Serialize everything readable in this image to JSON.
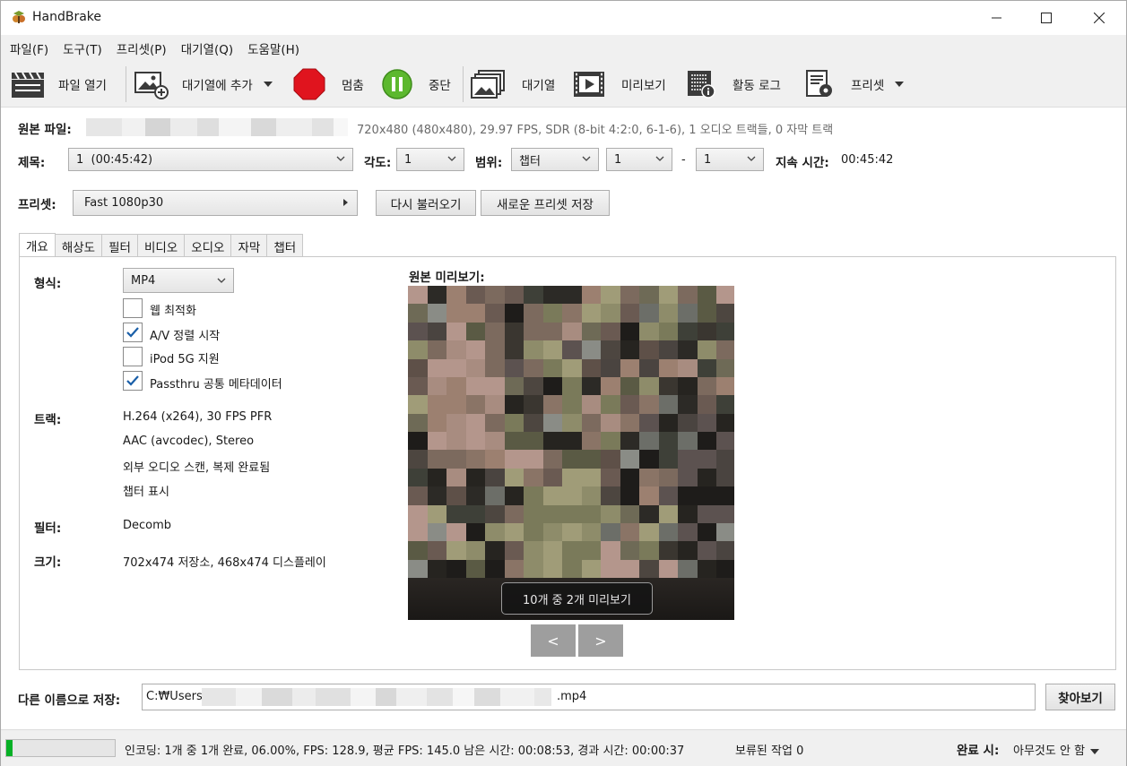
{
  "window": {
    "title": "HandBrake"
  },
  "menu": [
    "파일(F)",
    "도구(T)",
    "프리셋(P)",
    "대기열(Q)",
    "도움말(H)"
  ],
  "toolbar": {
    "open_source": "파일 열기",
    "add_to_queue": "대기열에 추가",
    "stop": "멈춤",
    "pause": "중단",
    "queue": "대기열",
    "preview": "미리보기",
    "activity_log": "활동 로그",
    "presets": "프리셋"
  },
  "source": {
    "label": "원본 파일:",
    "info": "720x480 (480x480), 29.97 FPS, SDR (8-bit 4:2:0, 6-1-6), 1 오디오 트랙들, 0 자막 트랙"
  },
  "title_row": {
    "title_label": "제목:",
    "title_value": "1  (00:45:42)",
    "angle_label": "각도:",
    "angle_value": "1",
    "range_label": "범위:",
    "range_type": "챕터",
    "range_start": "1",
    "range_sep": "-",
    "range_end": "1",
    "duration_label": "지속 시간:",
    "duration_value": "00:45:42"
  },
  "preset_row": {
    "label": "프리셋:",
    "value": "Fast 1080p30",
    "reload_button": "다시 불러오기",
    "save_new_button": "새로운 프리셋 저장"
  },
  "tabs": [
    "개요",
    "해상도",
    "필터",
    "비디오",
    "오디오",
    "자막",
    "챕터"
  ],
  "summary": {
    "format_label": "형식:",
    "format_value": "MP4",
    "options": [
      {
        "label": "웹 최적화",
        "checked": false
      },
      {
        "label": "A/V 정렬 시작",
        "checked": true
      },
      {
        "label": "iPod 5G 지원",
        "checked": false
      },
      {
        "label": "Passthru 공통 메타데이터",
        "checked": true
      }
    ],
    "tracks_label": "트랙:",
    "tracks": [
      "H.264 (x264), 30 FPS PFR",
      "AAC (avcodec), Stereo",
      "외부 오디오 스캔, 복제 완료됨",
      "챕터 표시"
    ],
    "filters_label": "필터:",
    "filters_value": "Decomb",
    "size_label": "크기:",
    "size_value": "702x474 저장소, 468x474 디스플레이",
    "preview_label": "원본 미리보기:",
    "preview_caption": "10개 중 2개 미리보기",
    "prev_button": "<",
    "next_button": ">"
  },
  "save_as": {
    "label": "다른 이름으로 저장:",
    "path_prefix": "C:₩Users₩",
    "path_suffix": ".mp4",
    "browse_button": "찾아보기"
  },
  "status": {
    "progress_percent": 6,
    "text": "인코딩: 1개 중 1개 완료, 06.00%, FPS: 128.9, 평균 FPS: 145.0 남은 시간: 00:08:53, 경과 시간: 00:00:37",
    "pending": "보류된 작업 0",
    "when_done_label": "완료 시:",
    "when_done_value": "아무것도 안 함"
  },
  "colors": {
    "accent": "#005fb8",
    "stop_red": "#e0141e",
    "pause_green": "#5cb82e",
    "progress_green": "#06b025"
  }
}
